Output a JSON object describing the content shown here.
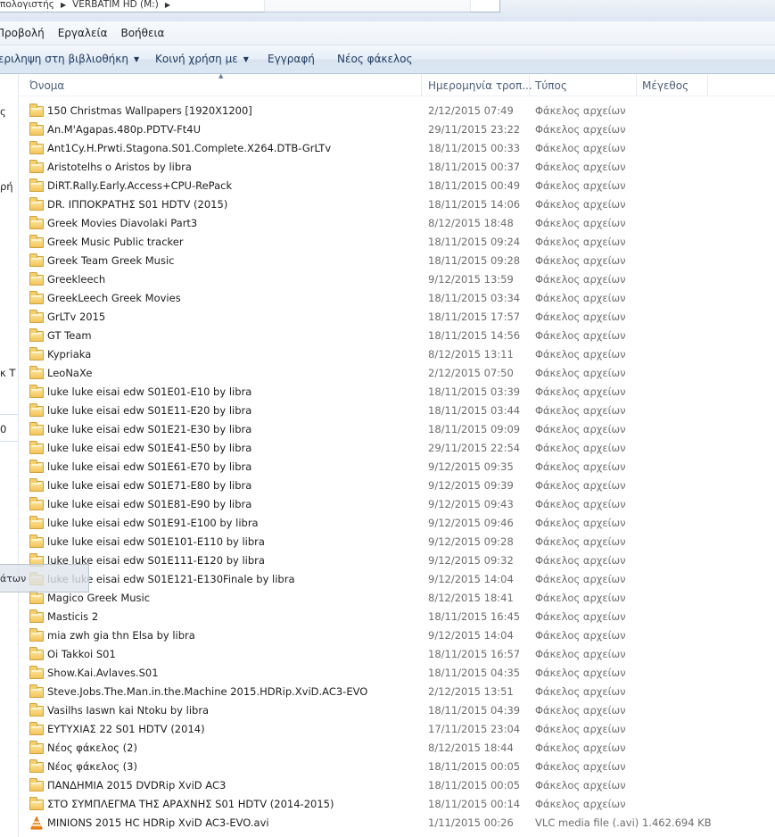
{
  "address": {
    "crumbs": [
      "πολογιστής",
      "VERBATIM HD (M:)"
    ]
  },
  "menu": {
    "items": [
      "Προβολή",
      "Εργαλεία",
      "Βοήθεια"
    ]
  },
  "commands": {
    "include_library": "εριληψη στη βιβλιοθήκη",
    "share_with": "Κοινή χρήση με",
    "burn": "Εγγραφή",
    "new_folder": "Νέος φάκελος"
  },
  "navpane": {
    "fragments": [
      "ς",
      "ρή",
      "κ Τ",
      "0"
    ],
    "tooltip": "άτων"
  },
  "columns": {
    "name": "Όνομα",
    "date": "Ημερομηνία τροπ...",
    "type": "Τύπος",
    "size": "Μέγεθος"
  },
  "files": [
    {
      "name": "150 Christmas Wallpapers [1920X1200]",
      "date": "2/12/2015 07:49",
      "type": "Φάκελος αρχείων",
      "size": "",
      "icon": "folder-icon"
    },
    {
      "name": "An.M'Agapas.480p.PDTV-Ft4U",
      "date": "29/11/2015 23:22",
      "type": "Φάκελος αρχείων",
      "size": "",
      "icon": "folder-icon"
    },
    {
      "name": "Ant1Cy.H.Prwti.Stagona.S01.Complete.X264.DTB-GrLTv",
      "date": "18/11/2015 00:33",
      "type": "Φάκελος αρχείων",
      "size": "",
      "icon": "folder-icon"
    },
    {
      "name": "Aristotelhs o Aristos by libra",
      "date": "18/11/2015 00:37",
      "type": "Φάκελος αρχείων",
      "size": "",
      "icon": "folder-icon"
    },
    {
      "name": "DiRT.Rally.Early.Access+CPU-RePack",
      "date": "18/11/2015 00:49",
      "type": "Φάκελος αρχείων",
      "size": "",
      "icon": "folder-icon"
    },
    {
      "name": "DR. ΙΠΠΟΚΡΑΤΗΣ S01 HDTV (2015)",
      "date": "18/11/2015 14:06",
      "type": "Φάκελος αρχείων",
      "size": "",
      "icon": "folder-icon"
    },
    {
      "name": "Greek Movies Diavolaki Part3",
      "date": "8/12/2015 18:48",
      "type": "Φάκελος αρχείων",
      "size": "",
      "icon": "folder-icon"
    },
    {
      "name": "Greek Music Public tracker",
      "date": "18/11/2015 09:24",
      "type": "Φάκελος αρχείων",
      "size": "",
      "icon": "folder-icon"
    },
    {
      "name": "Greek Team Greek Music",
      "date": "18/11/2015 09:28",
      "type": "Φάκελος αρχείων",
      "size": "",
      "icon": "folder-icon"
    },
    {
      "name": "Greekleech",
      "date": "9/12/2015 13:59",
      "type": "Φάκελος αρχείων",
      "size": "",
      "icon": "folder-icon"
    },
    {
      "name": "GreekLeech Greek Movies",
      "date": "18/11/2015 03:34",
      "type": "Φάκελος αρχείων",
      "size": "",
      "icon": "folder-icon"
    },
    {
      "name": "GrLTv 2015",
      "date": "18/11/2015 17:57",
      "type": "Φάκελος αρχείων",
      "size": "",
      "icon": "folder-icon"
    },
    {
      "name": "GT Team",
      "date": "18/11/2015 14:56",
      "type": "Φάκελος αρχείων",
      "size": "",
      "icon": "folder-icon"
    },
    {
      "name": "Kypriaka",
      "date": "8/12/2015 13:11",
      "type": "Φάκελος αρχείων",
      "size": "",
      "icon": "folder-icon"
    },
    {
      "name": "LeoNaXe",
      "date": "2/12/2015 07:50",
      "type": "Φάκελος αρχείων",
      "size": "",
      "icon": "folder-icon"
    },
    {
      "name": "luke luke eisai edw S01E01-E10 by libra",
      "date": "18/11/2015 03:39",
      "type": "Φάκελος αρχείων",
      "size": "",
      "icon": "folder-icon"
    },
    {
      "name": "luke luke eisai edw S01E11-E20 by libra",
      "date": "18/11/2015 03:44",
      "type": "Φάκελος αρχείων",
      "size": "",
      "icon": "folder-icon"
    },
    {
      "name": "luke luke eisai edw S01E21-E30 by libra",
      "date": "18/11/2015 09:09",
      "type": "Φάκελος αρχείων",
      "size": "",
      "icon": "folder-icon"
    },
    {
      "name": "luke luke eisai edw S01E41-E50 by libra",
      "date": "29/11/2015 22:54",
      "type": "Φάκελος αρχείων",
      "size": "",
      "icon": "folder-icon"
    },
    {
      "name": "luke luke eisai edw S01E61-E70 by libra",
      "date": "9/12/2015 09:35",
      "type": "Φάκελος αρχείων",
      "size": "",
      "icon": "folder-icon"
    },
    {
      "name": "luke luke eisai edw S01E71-E80 by libra",
      "date": "9/12/2015 09:39",
      "type": "Φάκελος αρχείων",
      "size": "",
      "icon": "folder-icon"
    },
    {
      "name": "luke luke eisai edw S01E81-E90 by libra",
      "date": "9/12/2015 09:43",
      "type": "Φάκελος αρχείων",
      "size": "",
      "icon": "folder-icon"
    },
    {
      "name": "luke luke eisai edw S01E91-E100 by libra",
      "date": "9/12/2015 09:46",
      "type": "Φάκελος αρχείων",
      "size": "",
      "icon": "folder-icon"
    },
    {
      "name": "luke luke eisai edw S01E101-E110 by libra",
      "date": "9/12/2015 09:28",
      "type": "Φάκελος αρχείων",
      "size": "",
      "icon": "folder-icon"
    },
    {
      "name": "luke luke eisai edw S01E111-E120 by libra",
      "date": "9/12/2015 09:32",
      "type": "Φάκελος αρχείων",
      "size": "",
      "icon": "folder-icon"
    },
    {
      "name": "luke luke eisai edw S01E121-E130Finale by libra",
      "date": "9/12/2015 14:04",
      "type": "Φάκελος αρχείων",
      "size": "",
      "icon": "folder-icon"
    },
    {
      "name": "Magico Greek Music",
      "date": "8/12/2015 18:41",
      "type": "Φάκελος αρχείων",
      "size": "",
      "icon": "folder-icon"
    },
    {
      "name": "Masticis 2",
      "date": "18/11/2015 16:45",
      "type": "Φάκελος αρχείων",
      "size": "",
      "icon": "folder-icon"
    },
    {
      "name": "mia zwh gia thn Elsa by libra",
      "date": "9/12/2015 14:04",
      "type": "Φάκελος αρχείων",
      "size": "",
      "icon": "folder-icon"
    },
    {
      "name": "Oi Takkoi S01",
      "date": "18/11/2015 16:57",
      "type": "Φάκελος αρχείων",
      "size": "",
      "icon": "folder-icon"
    },
    {
      "name": "Show.Kai.Avlaves.S01",
      "date": "18/11/2015 04:35",
      "type": "Φάκελος αρχείων",
      "size": "",
      "icon": "folder-icon"
    },
    {
      "name": "Steve.Jobs.The.Man.in.the.Machine 2015.HDRip.XviD.AC3-EVO",
      "date": "2/12/2015 13:51",
      "type": "Φάκελος αρχείων",
      "size": "",
      "icon": "folder-icon"
    },
    {
      "name": "Vasilhs Iaswn kai Ntoku by libra",
      "date": "18/11/2015 04:39",
      "type": "Φάκελος αρχείων",
      "size": "",
      "icon": "folder-icon"
    },
    {
      "name": "ΕΥΤΥΧΙΑΣ 22 S01 HDTV (2014)",
      "date": "17/11/2015 23:04",
      "type": "Φάκελος αρχείων",
      "size": "",
      "icon": "folder-icon"
    },
    {
      "name": "Νέος φάκελος (2)",
      "date": "8/12/2015 18:44",
      "type": "Φάκελος αρχείων",
      "size": "",
      "icon": "folder-icon"
    },
    {
      "name": "Νέος φάκελος (3)",
      "date": "18/11/2015 00:05",
      "type": "Φάκελος αρχείων",
      "size": "",
      "icon": "folder-icon"
    },
    {
      "name": "ΠΑΝΔΗΜΙΑ 2015 DVDRip XviD AC3",
      "date": "18/11/2015 00:05",
      "type": "Φάκελος αρχείων",
      "size": "",
      "icon": "folder-icon"
    },
    {
      "name": "ΣΤΟ ΣΥΜΠΛΕΓΜΑ ΤΗΣ ΑΡΑΧΝΗΣ S01 HDTV (2014-2015)",
      "date": "18/11/2015 00:14",
      "type": "Φάκελος αρχείων",
      "size": "",
      "icon": "folder-icon"
    },
    {
      "name": "MINIONS 2015 HC HDRip XviD AC3-EVO.avi",
      "date": "1/11/2015 00:26",
      "type": "VLC media file (.avi)",
      "size": "1.462.694 KB",
      "icon": "vlc-file-icon"
    }
  ]
}
